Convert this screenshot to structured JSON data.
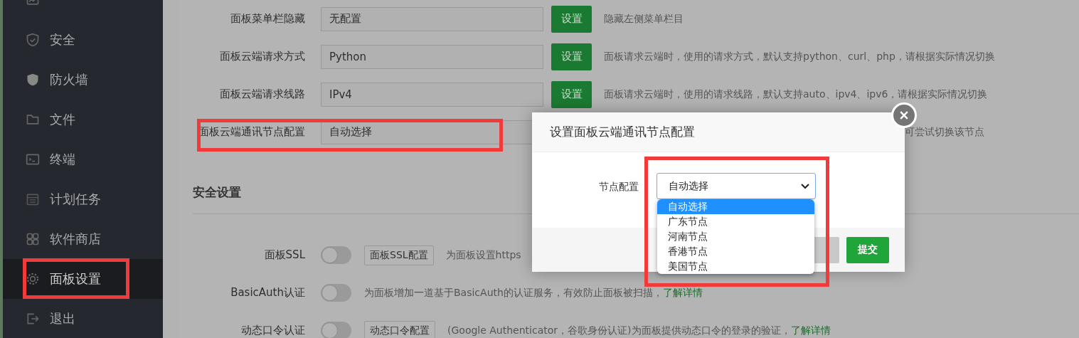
{
  "sidebar": {
    "items": [
      {
        "selected": false,
        "highlighted": false
      },
      {
        "label": "安全",
        "selected": false,
        "highlighted": false
      },
      {
        "label": "防火墙",
        "selected": false,
        "highlighted": false
      },
      {
        "label": "文件",
        "selected": false,
        "highlighted": false
      },
      {
        "label": "终端",
        "selected": false,
        "highlighted": false
      },
      {
        "label": "计划任务",
        "selected": false,
        "highlighted": false
      },
      {
        "label": "软件商店",
        "selected": false,
        "highlighted": false
      },
      {
        "label": "面板设置",
        "selected": true,
        "highlighted": true
      },
      {
        "label": "退出",
        "selected": false,
        "highlighted": false
      }
    ]
  },
  "settings": [
    {
      "label": "面板菜单栏隐藏",
      "value": "无配置",
      "button": "设置",
      "description": "隐藏左侧菜单栏目"
    },
    {
      "label": "面板云端请求方式",
      "value": "Python",
      "button": "设置",
      "description": "面板请求云端时，使用的请求方式，默认支持python、curl、php，请根据实际情况切换"
    },
    {
      "label": "面板云端请求线路",
      "value": "IPv4",
      "button": "设置",
      "description": "面板请求云端时，使用的请求线路，默认支持auto、ipv4、ipv6，请根据实际情况切换"
    },
    {
      "label": "面板云端通讯节点配置",
      "value": "自动选择",
      "description": "可尝试切换该节点",
      "highlighted": true
    }
  ],
  "security": {
    "title": "安全设置",
    "rows": [
      {
        "label": "面板SSL",
        "on": false,
        "button": "面板SSL配置",
        "description": "为面板设置https"
      },
      {
        "label": "BasicAuth认证",
        "on": false,
        "description": "为面板增加一道基于BasicAuth的认证服务，有效防止面板被扫描，",
        "link": "了解详情"
      },
      {
        "label": "动态口令认证",
        "on": false,
        "button": "动态口令配置",
        "description": "(Google Authenticator，谷歌身份认证)为面板提供动态口令的登录的验证，",
        "link": "了解详情"
      }
    ]
  },
  "modal": {
    "title": "设置面板云端通讯节点配置",
    "field_label": "节点配置",
    "select": {
      "value": "自动选择",
      "expanded": true,
      "highlighted": true,
      "options": [
        {
          "label": "自动选择",
          "selected": true
        },
        {
          "label": "广东节点",
          "selected": false
        },
        {
          "label": "河南节点",
          "selected": false
        },
        {
          "label": "香港节点",
          "selected": false
        },
        {
          "label": "美国节点",
          "selected": false
        }
      ]
    },
    "buttons": [
      {
        "kind": "secondary"
      },
      {
        "kind": "primary",
        "label": "提交"
      }
    ]
  }
}
